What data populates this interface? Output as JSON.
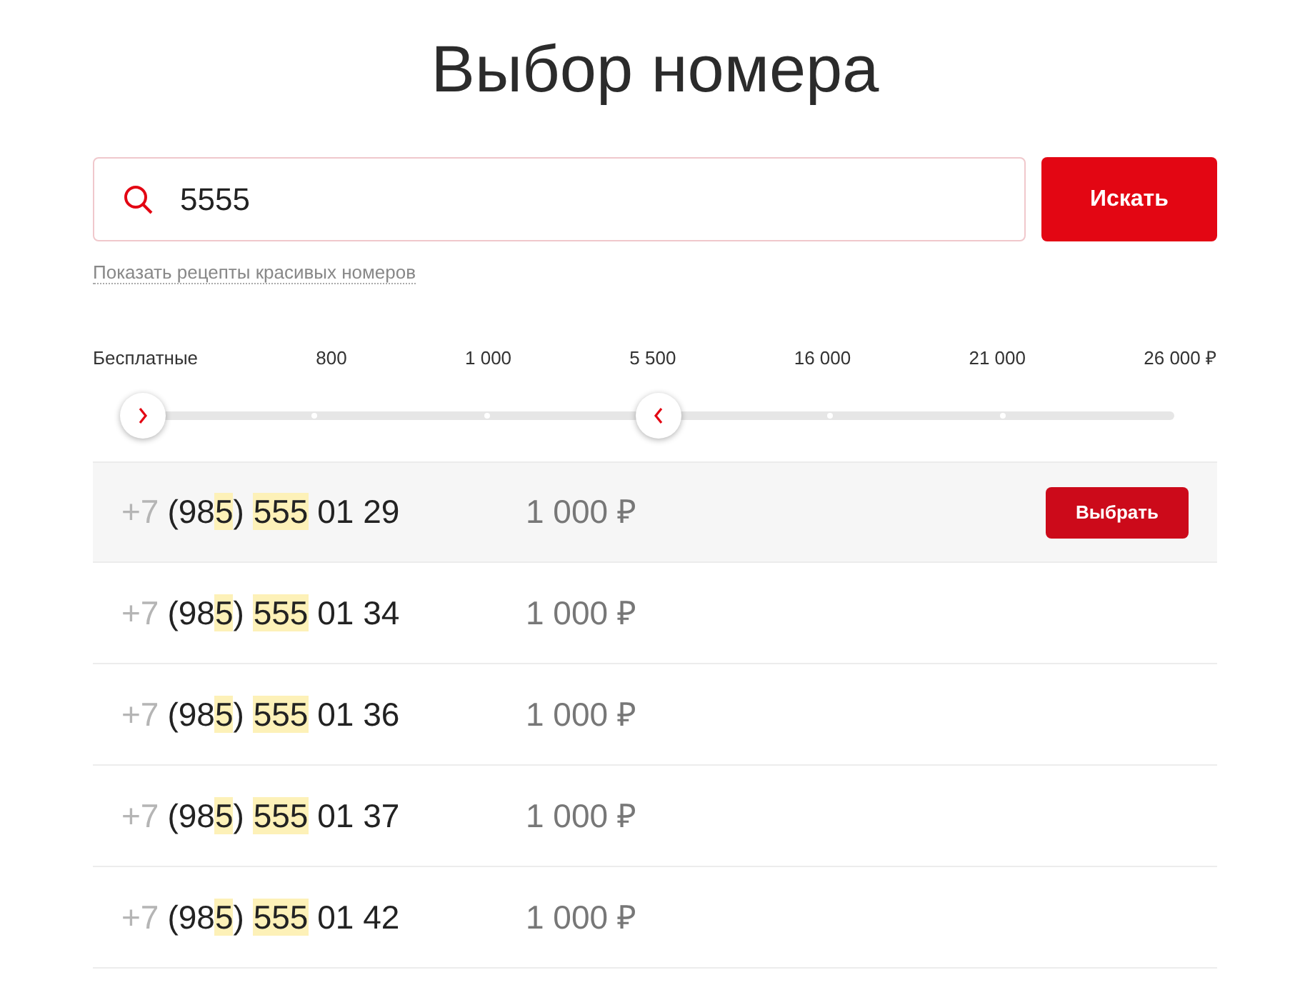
{
  "title": "Выбор номера",
  "search": {
    "value": "5555",
    "button": "Искать",
    "link": "Показать рецепты красивых номеров"
  },
  "price_slider": {
    "ticks": [
      "Бесплатные",
      "800",
      "1 000",
      "5 500",
      "16 000",
      "21 000",
      "26 000 ₽"
    ],
    "thumbs": [
      {
        "kind": "right",
        "level": 0
      },
      {
        "kind": "left",
        "level": 0.5
      }
    ]
  },
  "select_button": "Выбрать",
  "numbers": [
    {
      "selected": true,
      "price": "1 000 ₽",
      "parts": [
        {
          "kind": "prefix",
          "text": "+7"
        },
        {
          "kind": "plain",
          "text": "(98"
        },
        {
          "kind": "match",
          "text": "5"
        },
        {
          "kind": "plain",
          "text": ") "
        },
        {
          "kind": "match",
          "text": "555"
        },
        {
          "kind": "plain",
          "text": " 01 29"
        }
      ]
    },
    {
      "selected": false,
      "price": "1 000 ₽",
      "parts": [
        {
          "kind": "prefix",
          "text": "+7"
        },
        {
          "kind": "plain",
          "text": "(98"
        },
        {
          "kind": "match",
          "text": "5"
        },
        {
          "kind": "plain",
          "text": ") "
        },
        {
          "kind": "match",
          "text": "555"
        },
        {
          "kind": "plain",
          "text": " 01 34"
        }
      ]
    },
    {
      "selected": false,
      "price": "1 000 ₽",
      "parts": [
        {
          "kind": "prefix",
          "text": "+7"
        },
        {
          "kind": "plain",
          "text": "(98"
        },
        {
          "kind": "match",
          "text": "5"
        },
        {
          "kind": "plain",
          "text": ") "
        },
        {
          "kind": "match",
          "text": "555"
        },
        {
          "kind": "plain",
          "text": " 01 36"
        }
      ]
    },
    {
      "selected": false,
      "price": "1 000 ₽",
      "parts": [
        {
          "kind": "prefix",
          "text": "+7"
        },
        {
          "kind": "plain",
          "text": "(98"
        },
        {
          "kind": "match",
          "text": "5"
        },
        {
          "kind": "plain",
          "text": ") "
        },
        {
          "kind": "match",
          "text": "555"
        },
        {
          "kind": "plain",
          "text": " 01 37"
        }
      ]
    },
    {
      "selected": false,
      "price": "1 000 ₽",
      "parts": [
        {
          "kind": "prefix",
          "text": "+7"
        },
        {
          "kind": "plain",
          "text": "(98"
        },
        {
          "kind": "match",
          "text": "5"
        },
        {
          "kind": "plain",
          "text": ") "
        },
        {
          "kind": "match",
          "text": "555"
        },
        {
          "kind": "plain",
          "text": " 01 42"
        }
      ]
    }
  ]
}
